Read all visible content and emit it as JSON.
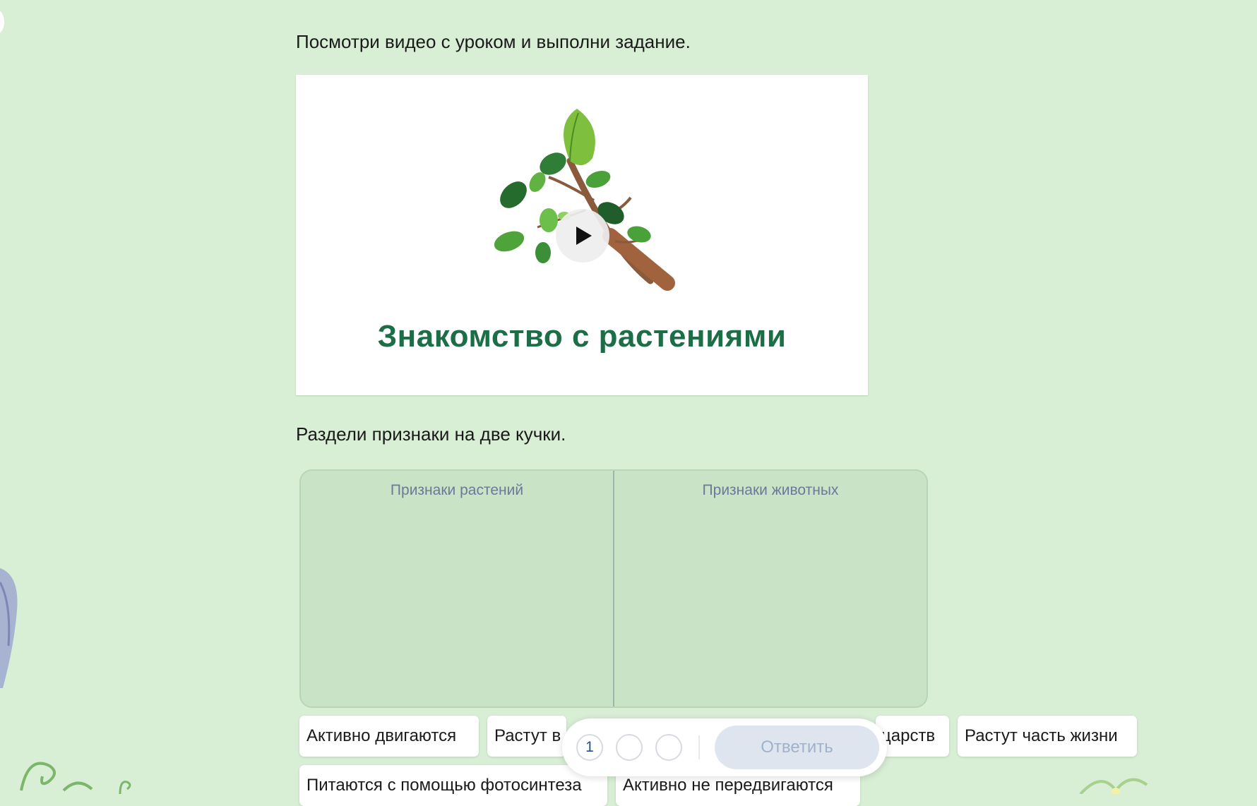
{
  "instruction": "Посмотри видео с уроком и выполни задание.",
  "video": {
    "title": "Знакомство с растениями",
    "play_icon": "play-icon"
  },
  "task": {
    "prompt": "Раздели признаки на две кучки."
  },
  "sorting_board": {
    "columns": [
      {
        "header": "Признаки растений"
      },
      {
        "header": "Признаки  животных"
      }
    ]
  },
  "cards": [
    {
      "label": "Активно двигаются"
    },
    {
      "label": "Растут в"
    },
    {
      "label": "царств"
    },
    {
      "label": "Растут часть жизни"
    },
    {
      "label": "Питаются с помощью фотосинтеза"
    },
    {
      "label": "Активно не передвигаются"
    }
  ],
  "answer_bar": {
    "steps": [
      {
        "label": "1"
      },
      {
        "label": ""
      },
      {
        "label": ""
      }
    ],
    "current_step": 1,
    "submit_label": "Ответить"
  },
  "colors": {
    "page_background": "#d8eed5",
    "board_background": "#c9e3c7",
    "video_title": "#1b6e45",
    "column_header": "#6a7a98",
    "step_text": "#1f4f9a",
    "submit_disabled_bg": "#dfe5ef",
    "submit_disabled_text": "#9fb2cc"
  }
}
